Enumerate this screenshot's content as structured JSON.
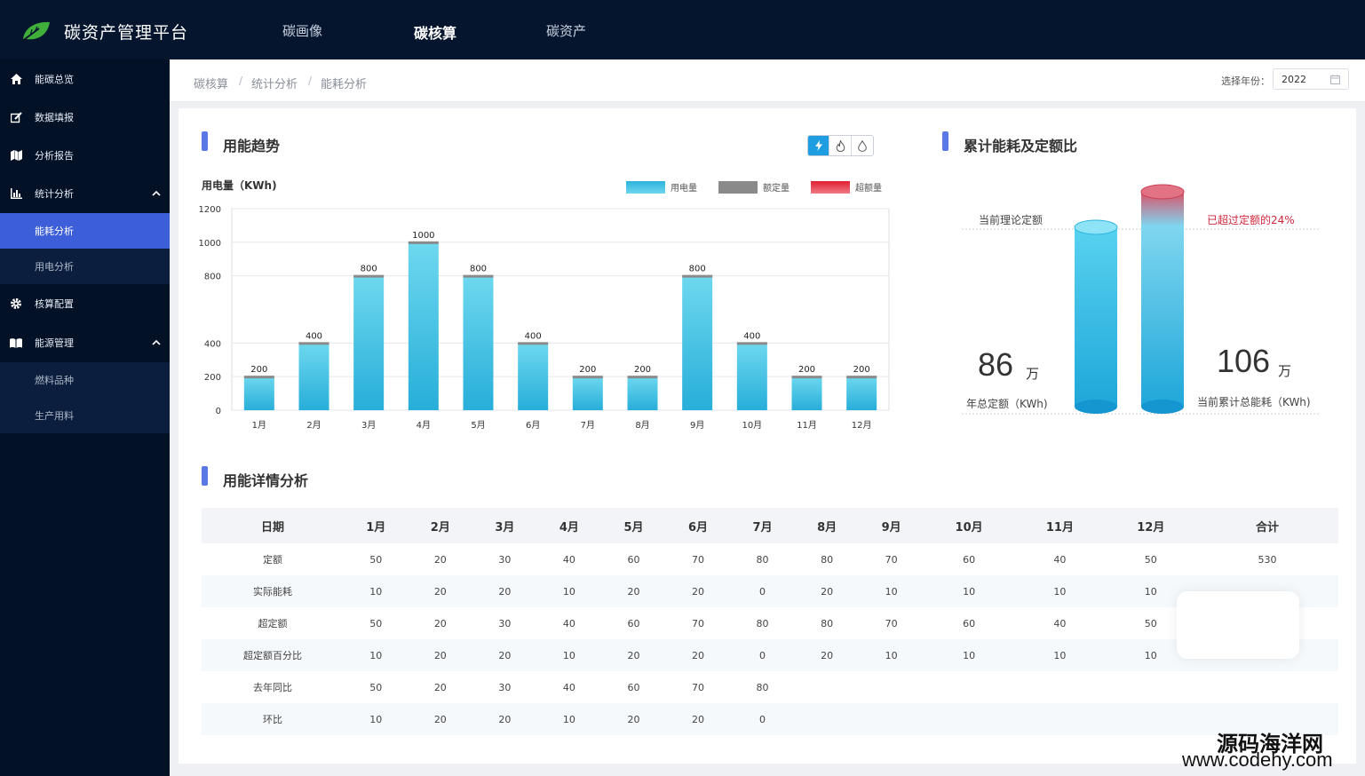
{
  "header": {
    "app_title": "碳资产管理平台",
    "nav": [
      {
        "label": "碳画像",
        "active": false
      },
      {
        "label": "碳核算",
        "active": true
      },
      {
        "label": "碳资产",
        "active": false
      }
    ]
  },
  "sidebar": {
    "items": [
      {
        "label": "能碳总览",
        "icon": "home-icon"
      },
      {
        "label": "数据填报",
        "icon": "edit-icon"
      },
      {
        "label": "分析报告",
        "icon": "map-icon"
      },
      {
        "label": "统计分析",
        "icon": "bar-chart-icon",
        "expanded": true,
        "children": [
          {
            "label": "能耗分析",
            "active": true
          },
          {
            "label": "用电分析",
            "active": false
          }
        ]
      },
      {
        "label": "核算配置",
        "icon": "gear-icon"
      },
      {
        "label": "能源管理",
        "icon": "book-icon",
        "expanded": true,
        "children": [
          {
            "label": "燃料品种",
            "active": false
          },
          {
            "label": "生产用料",
            "active": false
          }
        ]
      }
    ]
  },
  "breadcrumb": [
    "碳核算",
    "统计分析",
    "能耗分析"
  ],
  "year_select": {
    "label": "选择年份：",
    "value": "2022"
  },
  "trend": {
    "title": "用能趋势",
    "unit_label": "用电量（KWh)",
    "legend": [
      {
        "label": "用电量",
        "color": "#3bbfe0"
      },
      {
        "label": "额定量",
        "color": "#8a8a8a"
      },
      {
        "label": "超额量",
        "color": "#e03040"
      }
    ]
  },
  "chart_data": {
    "type": "bar",
    "categories": [
      "1月",
      "2月",
      "3月",
      "4月",
      "5月",
      "6月",
      "7月",
      "8月",
      "9月",
      "10月",
      "11月",
      "12月"
    ],
    "values": [
      200,
      400,
      800,
      1000,
      800,
      400,
      200,
      200,
      800,
      400,
      200,
      200
    ],
    "yticks": [
      0,
      200,
      400,
      800,
      1000,
      1200
    ],
    "ylim": [
      0,
      1200
    ]
  },
  "cumulative": {
    "title": "累计能耗及定额比",
    "theory_label": "当前理论定额",
    "exceed_label": "已超过定额的24%",
    "quota_value": "86",
    "quota_unit": "万",
    "quota_label": "年总定额（KWh)",
    "total_value": "106",
    "total_unit": "万",
    "total_label": "当前累计总能耗（KWh)"
  },
  "detail": {
    "title": "用能详情分析",
    "headers": [
      "日期",
      "1月",
      "2月",
      "3月",
      "4月",
      "5月",
      "6月",
      "7月",
      "8月",
      "9月",
      "10月",
      "11月",
      "12月",
      "合计"
    ],
    "rows": [
      [
        "定额",
        "50",
        "20",
        "30",
        "40",
        "60",
        "70",
        "80",
        "80",
        "70",
        "60",
        "40",
        "50",
        "530"
      ],
      [
        "实际能耗",
        "10",
        "20",
        "20",
        "10",
        "20",
        "20",
        "0",
        "20",
        "10",
        "10",
        "10",
        "10",
        ""
      ],
      [
        "超定额",
        "50",
        "20",
        "30",
        "40",
        "60",
        "70",
        "80",
        "80",
        "70",
        "60",
        "40",
        "50",
        ""
      ],
      [
        "超定额百分比",
        "10",
        "20",
        "20",
        "10",
        "20",
        "20",
        "0",
        "20",
        "10",
        "10",
        "10",
        "10",
        ""
      ],
      [
        "去年同比",
        "50",
        "20",
        "30",
        "40",
        "60",
        "70",
        "80",
        "",
        "",
        "",
        "",
        "",
        ""
      ],
      [
        "环比",
        "10",
        "20",
        "20",
        "10",
        "20",
        "20",
        "0",
        "",
        "",
        "",
        "",
        "",
        ""
      ]
    ]
  },
  "watermark": {
    "line1": "源码海洋网",
    "line2": "www.codehy.com"
  }
}
